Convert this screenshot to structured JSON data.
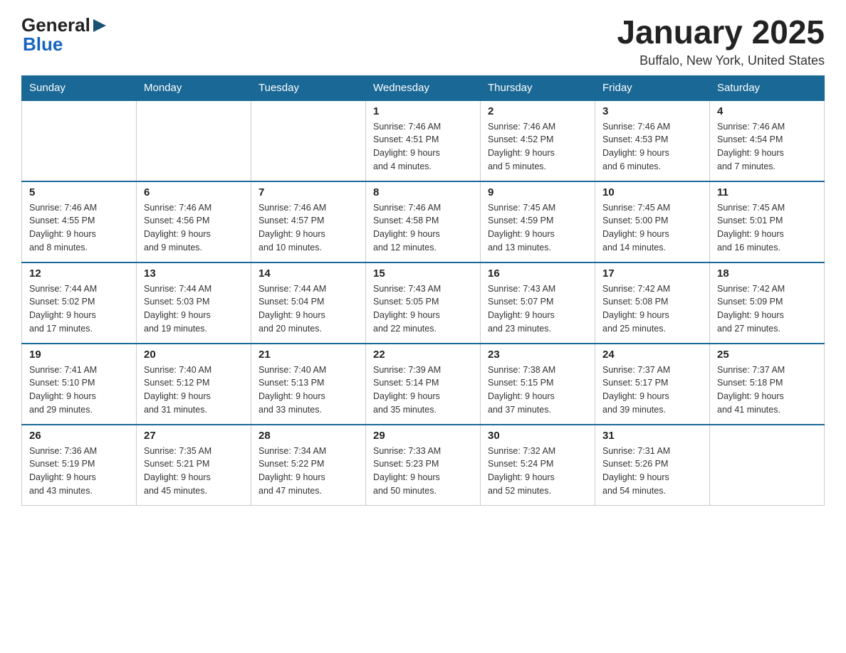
{
  "header": {
    "logo_general": "General",
    "logo_blue": "Blue",
    "month_title": "January 2025",
    "location": "Buffalo, New York, United States"
  },
  "days_of_week": [
    "Sunday",
    "Monday",
    "Tuesday",
    "Wednesday",
    "Thursday",
    "Friday",
    "Saturday"
  ],
  "weeks": [
    [
      {
        "day": "",
        "info": ""
      },
      {
        "day": "",
        "info": ""
      },
      {
        "day": "",
        "info": ""
      },
      {
        "day": "1",
        "info": "Sunrise: 7:46 AM\nSunset: 4:51 PM\nDaylight: 9 hours\nand 4 minutes."
      },
      {
        "day": "2",
        "info": "Sunrise: 7:46 AM\nSunset: 4:52 PM\nDaylight: 9 hours\nand 5 minutes."
      },
      {
        "day": "3",
        "info": "Sunrise: 7:46 AM\nSunset: 4:53 PM\nDaylight: 9 hours\nand 6 minutes."
      },
      {
        "day": "4",
        "info": "Sunrise: 7:46 AM\nSunset: 4:54 PM\nDaylight: 9 hours\nand 7 minutes."
      }
    ],
    [
      {
        "day": "5",
        "info": "Sunrise: 7:46 AM\nSunset: 4:55 PM\nDaylight: 9 hours\nand 8 minutes."
      },
      {
        "day": "6",
        "info": "Sunrise: 7:46 AM\nSunset: 4:56 PM\nDaylight: 9 hours\nand 9 minutes."
      },
      {
        "day": "7",
        "info": "Sunrise: 7:46 AM\nSunset: 4:57 PM\nDaylight: 9 hours\nand 10 minutes."
      },
      {
        "day": "8",
        "info": "Sunrise: 7:46 AM\nSunset: 4:58 PM\nDaylight: 9 hours\nand 12 minutes."
      },
      {
        "day": "9",
        "info": "Sunrise: 7:45 AM\nSunset: 4:59 PM\nDaylight: 9 hours\nand 13 minutes."
      },
      {
        "day": "10",
        "info": "Sunrise: 7:45 AM\nSunset: 5:00 PM\nDaylight: 9 hours\nand 14 minutes."
      },
      {
        "day": "11",
        "info": "Sunrise: 7:45 AM\nSunset: 5:01 PM\nDaylight: 9 hours\nand 16 minutes."
      }
    ],
    [
      {
        "day": "12",
        "info": "Sunrise: 7:44 AM\nSunset: 5:02 PM\nDaylight: 9 hours\nand 17 minutes."
      },
      {
        "day": "13",
        "info": "Sunrise: 7:44 AM\nSunset: 5:03 PM\nDaylight: 9 hours\nand 19 minutes."
      },
      {
        "day": "14",
        "info": "Sunrise: 7:44 AM\nSunset: 5:04 PM\nDaylight: 9 hours\nand 20 minutes."
      },
      {
        "day": "15",
        "info": "Sunrise: 7:43 AM\nSunset: 5:05 PM\nDaylight: 9 hours\nand 22 minutes."
      },
      {
        "day": "16",
        "info": "Sunrise: 7:43 AM\nSunset: 5:07 PM\nDaylight: 9 hours\nand 23 minutes."
      },
      {
        "day": "17",
        "info": "Sunrise: 7:42 AM\nSunset: 5:08 PM\nDaylight: 9 hours\nand 25 minutes."
      },
      {
        "day": "18",
        "info": "Sunrise: 7:42 AM\nSunset: 5:09 PM\nDaylight: 9 hours\nand 27 minutes."
      }
    ],
    [
      {
        "day": "19",
        "info": "Sunrise: 7:41 AM\nSunset: 5:10 PM\nDaylight: 9 hours\nand 29 minutes."
      },
      {
        "day": "20",
        "info": "Sunrise: 7:40 AM\nSunset: 5:12 PM\nDaylight: 9 hours\nand 31 minutes."
      },
      {
        "day": "21",
        "info": "Sunrise: 7:40 AM\nSunset: 5:13 PM\nDaylight: 9 hours\nand 33 minutes."
      },
      {
        "day": "22",
        "info": "Sunrise: 7:39 AM\nSunset: 5:14 PM\nDaylight: 9 hours\nand 35 minutes."
      },
      {
        "day": "23",
        "info": "Sunrise: 7:38 AM\nSunset: 5:15 PM\nDaylight: 9 hours\nand 37 minutes."
      },
      {
        "day": "24",
        "info": "Sunrise: 7:37 AM\nSunset: 5:17 PM\nDaylight: 9 hours\nand 39 minutes."
      },
      {
        "day": "25",
        "info": "Sunrise: 7:37 AM\nSunset: 5:18 PM\nDaylight: 9 hours\nand 41 minutes."
      }
    ],
    [
      {
        "day": "26",
        "info": "Sunrise: 7:36 AM\nSunset: 5:19 PM\nDaylight: 9 hours\nand 43 minutes."
      },
      {
        "day": "27",
        "info": "Sunrise: 7:35 AM\nSunset: 5:21 PM\nDaylight: 9 hours\nand 45 minutes."
      },
      {
        "day": "28",
        "info": "Sunrise: 7:34 AM\nSunset: 5:22 PM\nDaylight: 9 hours\nand 47 minutes."
      },
      {
        "day": "29",
        "info": "Sunrise: 7:33 AM\nSunset: 5:23 PM\nDaylight: 9 hours\nand 50 minutes."
      },
      {
        "day": "30",
        "info": "Sunrise: 7:32 AM\nSunset: 5:24 PM\nDaylight: 9 hours\nand 52 minutes."
      },
      {
        "day": "31",
        "info": "Sunrise: 7:31 AM\nSunset: 5:26 PM\nDaylight: 9 hours\nand 54 minutes."
      },
      {
        "day": "",
        "info": ""
      }
    ]
  ]
}
